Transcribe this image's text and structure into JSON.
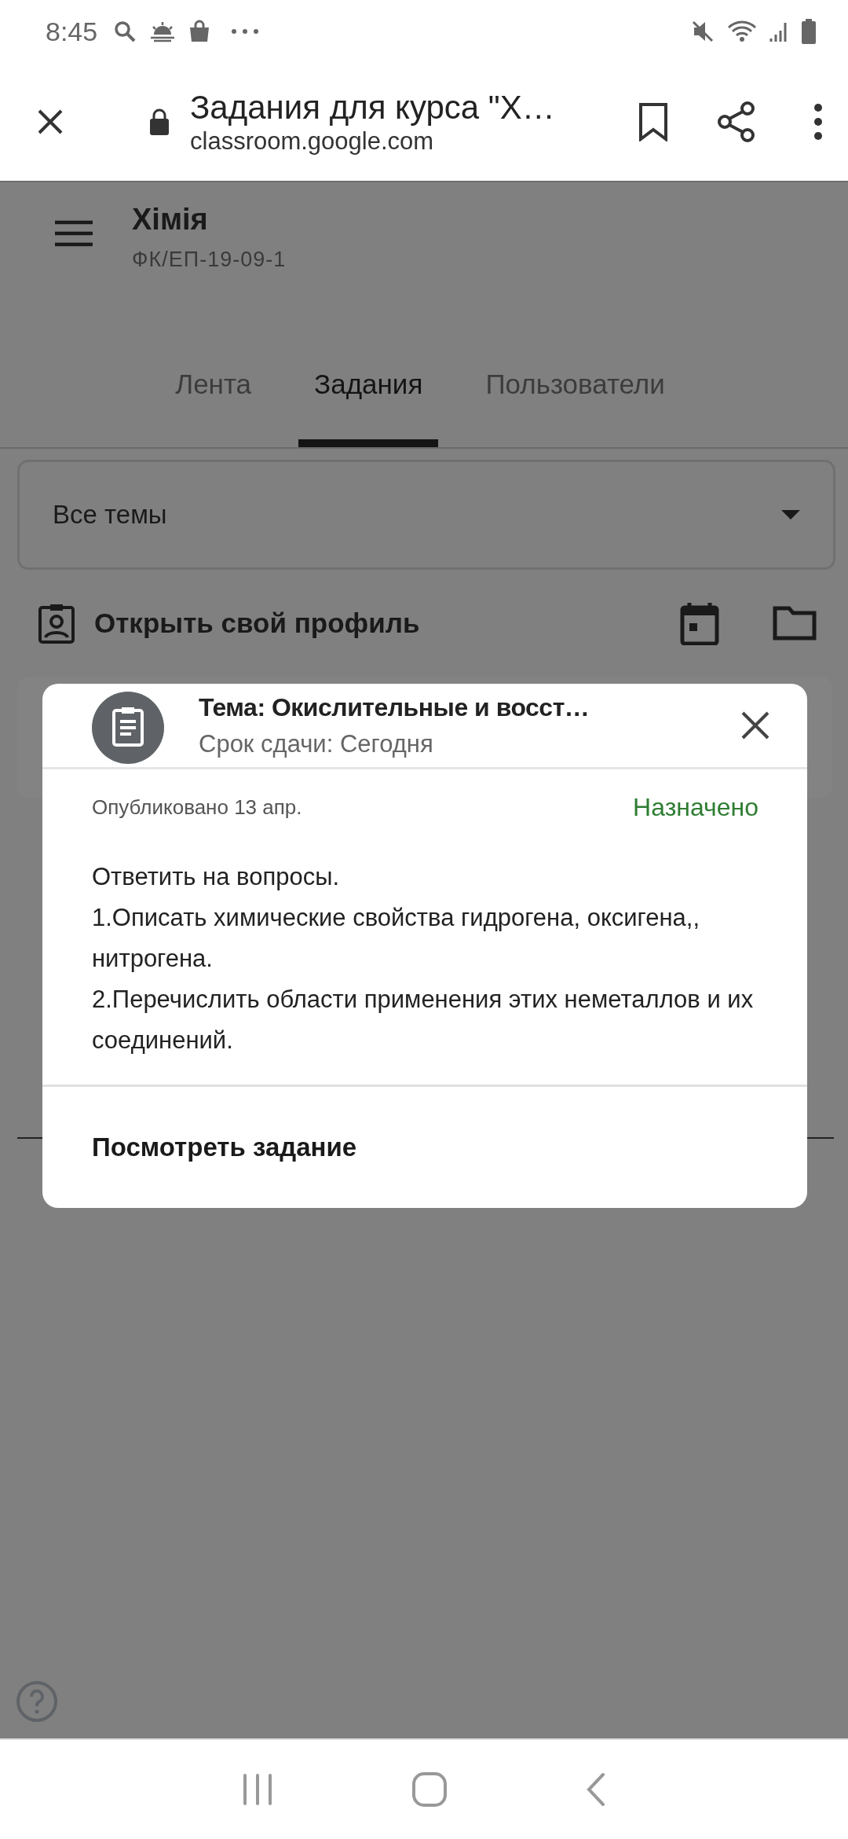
{
  "status_bar": {
    "time": "8:45"
  },
  "browser": {
    "title": "Задания для курса \"Х…",
    "url": "classroom.google.com"
  },
  "course": {
    "name": "Хімія",
    "section": "ФК/ЕП-19-09-1"
  },
  "tabs": [
    {
      "label": "Лента",
      "selected": false
    },
    {
      "label": "Задания",
      "selected": true
    },
    {
      "label": "Пользователи",
      "selected": false
    }
  ],
  "topic_filter": {
    "value": "Все темы"
  },
  "profile_link": {
    "label": "Открыть свой профиль"
  },
  "dialog": {
    "title": "Тема: Окислительные и восст…",
    "due": "Срок сдачи: Сегодня",
    "posted": "Опубликовано 13 апр.",
    "status": "Назначено",
    "description": [
      "Ответить на вопросы.",
      "1.Описать химические свойства гидрогена, оксигена,, нитрогена.",
      "2.Перечислить области применения этих неметаллов и их соединений."
    ],
    "action": "Посмотреть задание"
  }
}
